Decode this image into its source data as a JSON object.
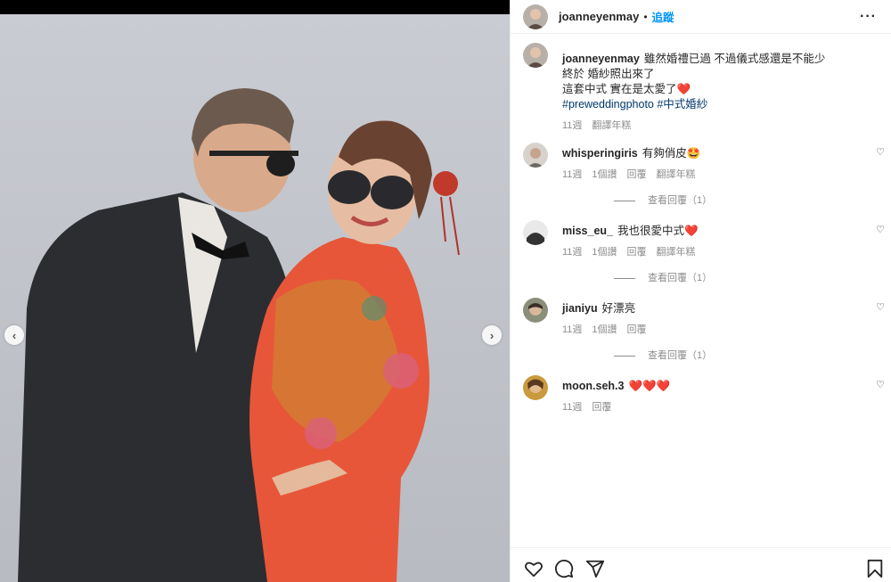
{
  "post": {
    "username": "joanneyenmay",
    "separator": "•",
    "follow_label": "追蹤",
    "more_label": "···",
    "caption": {
      "username": "joanneyenmay",
      "line1": "雖然婚禮已過 不過儀式感還是不能少",
      "line2": "終於 婚紗照出來了",
      "line3": "這套中式 實在是太愛了",
      "line3_emoji": "❤️",
      "hashtag1": "#preweddingphoto",
      "hashtag2": "#中式婚紗",
      "time": "11週",
      "translate": "翻譯年糕"
    }
  },
  "comments": [
    {
      "username": "whisperingiris",
      "text": "有夠俏皮🤩",
      "time": "11週",
      "likes": "1個讚",
      "reply": "回覆",
      "translate": "翻譯年糕",
      "view_replies": "查看回覆（1）"
    },
    {
      "username": "miss_eu_",
      "text": "我也很愛中式❤️",
      "time": "11週",
      "likes": "1個讚",
      "reply": "回覆",
      "translate": "翻譯年糕",
      "view_replies": "查看回覆（1）"
    },
    {
      "username": "jianiyu",
      "text": "好漂亮",
      "time": "11週",
      "likes": "1個讚",
      "reply": "回覆",
      "view_replies": "查看回覆（1）"
    },
    {
      "username": "moon.seh.3",
      "text": "❤️❤️❤️",
      "time": "11週",
      "reply": "回覆"
    }
  ],
  "icons": {
    "like": "heart-icon",
    "comment": "comment-icon",
    "share": "send-icon",
    "save": "bookmark-icon",
    "prev": "chevron-left-icon",
    "next": "chevron-right-icon"
  },
  "colors": {
    "accent": "#0095f6",
    "hashtag": "#00376b",
    "muted": "#8e8e8e"
  },
  "carousel": {
    "prev_label": "‹",
    "next_label": "›"
  }
}
